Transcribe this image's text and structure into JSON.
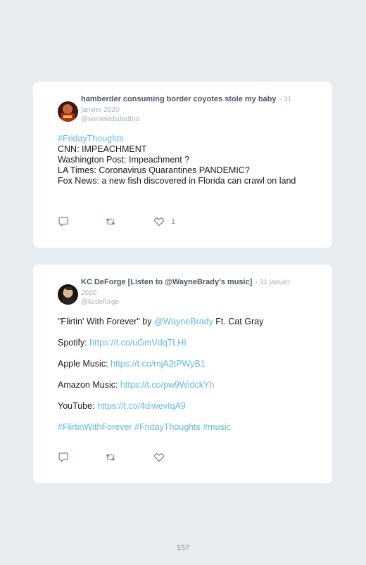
{
  "tweets": [
    {
      "author_name": "hamberder consuming border coyotes stole my baby",
      "date": "· 31 janvier 2020",
      "handle": "@somekidsdadtho",
      "hashtag": "#FridayThoughts",
      "lines": [
        "CNN: IMPEACHMENT",
        "Washington Post: Impeachment ?",
        "LA Times: Coronavirus Quarantines PANDEMIC?",
        "Fox News: a new fish discovered in Florida can crawl on land"
      ],
      "like_count": "1"
    },
    {
      "author_name": "KC DeForge [Listen to @WayneBrady's music]",
      "date": "· 31 janvier 2020",
      "handle": "@kcdeforge",
      "song_prefix": "\"Flirtin' With Forever\" by ",
      "song_mention": "@WayneBrady",
      "song_suffix": " Ft. Cat Gray",
      "spotify_label": "Spotify: ",
      "spotify_link": "https://t.co/uGmVdqTLHI",
      "apple_label": "Apple Music: ",
      "apple_link": "https://t.co/mjA2tPWyB1",
      "amazon_label": "Amazon Music: ",
      "amazon_link": "https://t.co/pw9WidckYh",
      "youtube_label": "YouTube: ",
      "youtube_link": "https://t.co/4diwevIqA9",
      "hashtags": "#FlirtinWithForever #FridayThoughts #music",
      "like_count": ""
    }
  ],
  "page_number": "157",
  "colors": {
    "link": "#63b8e6",
    "background": "#e6ecf0",
    "card": "#ffffff"
  },
  "icons": [
    "reply-icon",
    "retweet-icon",
    "like-icon"
  ]
}
